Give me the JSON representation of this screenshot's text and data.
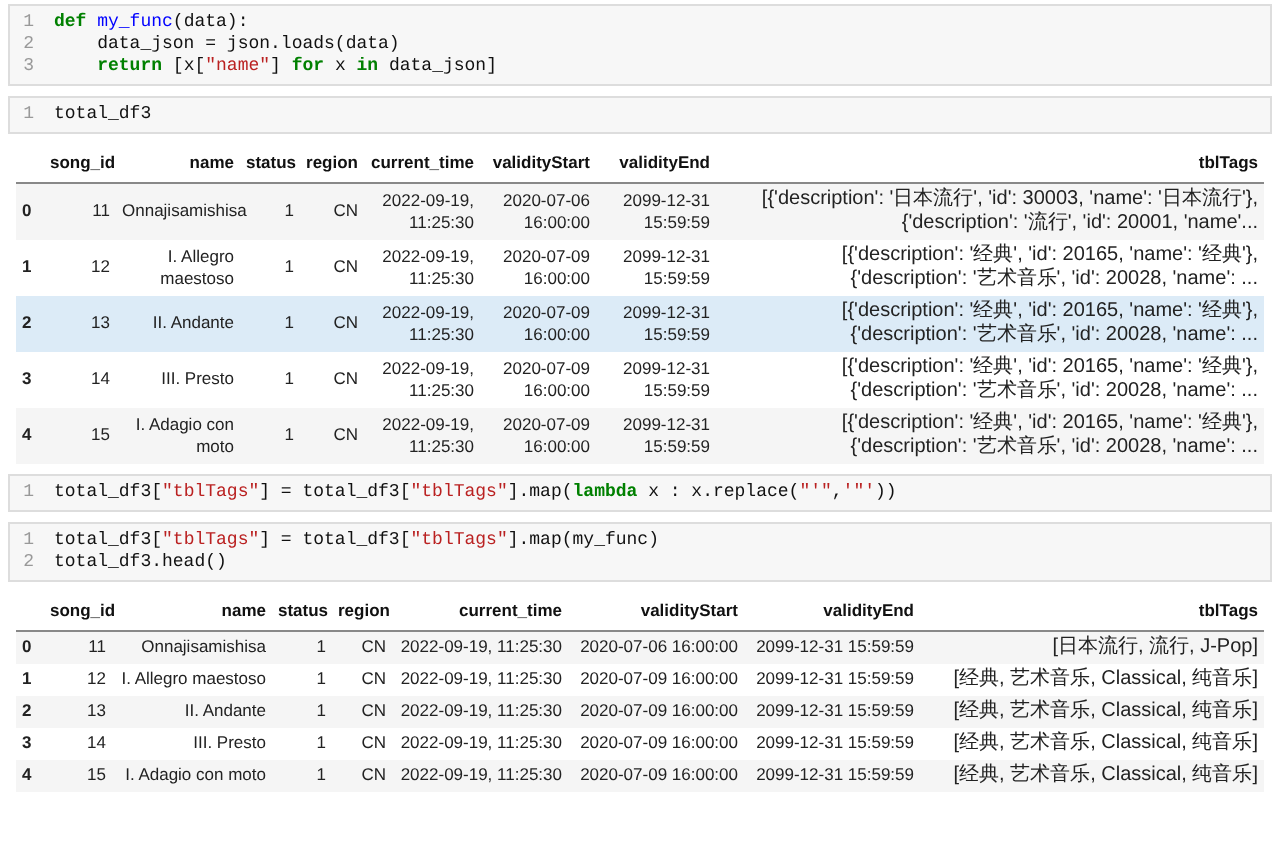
{
  "cells": [
    {
      "kind": "code",
      "lines": [
        {
          "number": "1",
          "tokens": [
            {
              "kind": "kw",
              "text": "def"
            },
            {
              "kind": "fn",
              "text": " my_func"
            },
            {
              "kind": "plain",
              "text": "(data):"
            }
          ]
        },
        {
          "number": "2",
          "tokens": [
            {
              "kind": "plain",
              "text": "    data_json = json.loads(data)"
            }
          ]
        },
        {
          "number": "3",
          "tokens": [
            {
              "kind": "kw",
              "text": "    return"
            },
            {
              "kind": "plain",
              "text": " [x["
            },
            {
              "kind": "str",
              "text": "\"name\""
            },
            {
              "kind": "plain",
              "text": "] "
            },
            {
              "kind": "kw",
              "text": "for"
            },
            {
              "kind": "plain",
              "text": " x "
            },
            {
              "kind": "kw",
              "text": "in"
            },
            {
              "kind": "plain",
              "text": " data_json]"
            }
          ]
        }
      ]
    },
    {
      "kind": "code",
      "lines": [
        {
          "number": "1",
          "tokens": [
            {
              "kind": "plain",
              "text": "total_df3"
            }
          ]
        }
      ]
    },
    {
      "kind": "wrapped_table",
      "columns": [
        "",
        "song_id",
        "name",
        "status",
        "region",
        "current_time",
        "validityStart",
        "validityEnd",
        "tblTags"
      ],
      "rows": [
        {
          "selected": false,
          "cells": [
            "0",
            "11",
            "Onnajisamishisa",
            "1",
            "CN",
            "2022-09-19, 11:25:30",
            "2020-07-06 16:00:00",
            "2099-12-31 15:59:59",
            "[{'description': '日本流行', 'id': 30003, 'name': '日本流行'}, {'description': '流行', 'id': 20001, 'name'..."
          ]
        },
        {
          "selected": false,
          "cells": [
            "1",
            "12",
            "I. Allegro maestoso",
            "1",
            "CN",
            "2022-09-19, 11:25:30",
            "2020-07-09 16:00:00",
            "2099-12-31 15:59:59",
            "[{'description': '经典', 'id': 20165, 'name': '经典'}, {'description': '艺术音乐', 'id': 20028, 'name': ..."
          ]
        },
        {
          "selected": true,
          "cells": [
            "2",
            "13",
            "II. Andante",
            "1",
            "CN",
            "2022-09-19, 11:25:30",
            "2020-07-09 16:00:00",
            "2099-12-31 15:59:59",
            "[{'description': '经典', 'id': 20165, 'name': '经典'}, {'description': '艺术音乐', 'id': 20028, 'name': ..."
          ]
        },
        {
          "selected": false,
          "cells": [
            "3",
            "14",
            "III. Presto",
            "1",
            "CN",
            "2022-09-19, 11:25:30",
            "2020-07-09 16:00:00",
            "2099-12-31 15:59:59",
            "[{'description': '经典', 'id': 20165, 'name': '经典'}, {'description': '艺术音乐', 'id': 20028, 'name': ..."
          ]
        },
        {
          "selected": false,
          "cells": [
            "4",
            "15",
            "I. Adagio con moto",
            "1",
            "CN",
            "2022-09-19, 11:25:30",
            "2020-07-09 16:00:00",
            "2099-12-31 15:59:59",
            "[{'description': '经典', 'id': 20165, 'name': '经典'}, {'description': '艺术音乐', 'id': 20028, 'name': ..."
          ]
        }
      ]
    },
    {
      "kind": "code",
      "lines": [
        {
          "number": "1",
          "tokens": [
            {
              "kind": "plain",
              "text": "total_df3["
            },
            {
              "kind": "str",
              "text": "\"tblTags\""
            },
            {
              "kind": "plain",
              "text": "] = total_df3["
            },
            {
              "kind": "str",
              "text": "\"tblTags\""
            },
            {
              "kind": "plain",
              "text": "].map("
            },
            {
              "kind": "kw",
              "text": "lambda"
            },
            {
              "kind": "plain",
              "text": " x : x.replace("
            },
            {
              "kind": "str",
              "text": "\"'\""
            },
            {
              "kind": "plain",
              "text": ","
            },
            {
              "kind": "str",
              "text": "'\"'"
            },
            {
              "kind": "plain",
              "text": "))"
            }
          ]
        }
      ]
    },
    {
      "kind": "code",
      "lines": [
        {
          "number": "1",
          "tokens": [
            {
              "kind": "plain",
              "text": "total_df3["
            },
            {
              "kind": "str",
              "text": "\"tblTags\""
            },
            {
              "kind": "plain",
              "text": "] = total_df3["
            },
            {
              "kind": "str",
              "text": "\"tblTags\""
            },
            {
              "kind": "plain",
              "text": "].map(my_func)"
            }
          ]
        },
        {
          "number": "2",
          "tokens": [
            {
              "kind": "plain",
              "text": "total_df3.head()"
            }
          ]
        }
      ]
    },
    {
      "kind": "table",
      "columns": [
        "",
        "song_id",
        "name",
        "status",
        "region",
        "current_time",
        "validityStart",
        "validityEnd",
        "tblTags"
      ],
      "rows": [
        {
          "selected": false,
          "cells": [
            "0",
            "11",
            "Onnajisamishisa",
            "1",
            "CN",
            "2022-09-19, 11:25:30",
            "2020-07-06 16:00:00",
            "2099-12-31 15:59:59",
            "[日本流行, 流行, J-Pop]"
          ]
        },
        {
          "selected": false,
          "cells": [
            "1",
            "12",
            "I. Allegro maestoso",
            "1",
            "CN",
            "2022-09-19, 11:25:30",
            "2020-07-09 16:00:00",
            "2099-12-31 15:59:59",
            "[经典, 艺术音乐, Classical, 纯音乐]"
          ]
        },
        {
          "selected": false,
          "cells": [
            "2",
            "13",
            "II. Andante",
            "1",
            "CN",
            "2022-09-19, 11:25:30",
            "2020-07-09 16:00:00",
            "2099-12-31 15:59:59",
            "[经典, 艺术音乐, Classical, 纯音乐]"
          ]
        },
        {
          "selected": false,
          "cells": [
            "3",
            "14",
            "III. Presto",
            "1",
            "CN",
            "2022-09-19, 11:25:30",
            "2020-07-09 16:00:00",
            "2099-12-31 15:59:59",
            "[经典, 艺术音乐, Classical, 纯音乐]"
          ]
        },
        {
          "selected": false,
          "cells": [
            "4",
            "15",
            "I. Adagio con moto",
            "1",
            "CN",
            "2022-09-19, 11:25:30",
            "2020-07-09 16:00:00",
            "2099-12-31 15:59:59",
            "[经典, 艺术音乐, Classical, 纯音乐]"
          ]
        }
      ]
    }
  ]
}
